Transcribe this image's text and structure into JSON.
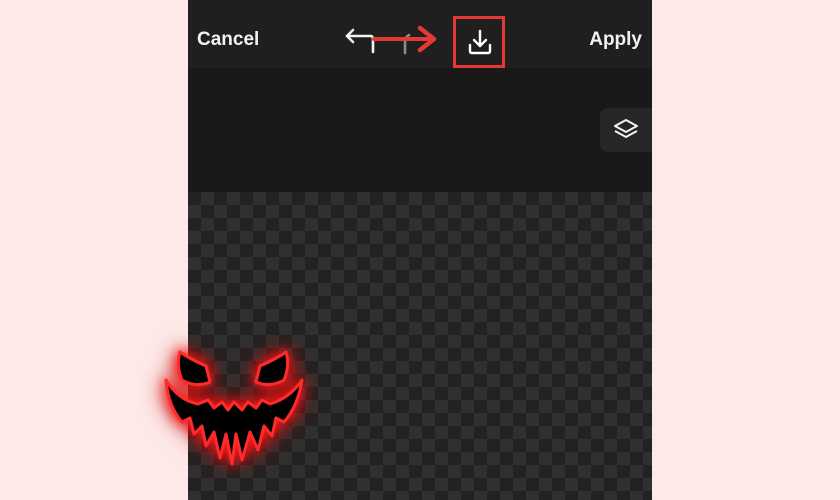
{
  "topbar": {
    "cancel_label": "Cancel",
    "apply_label": "Apply"
  },
  "icons": {
    "undo": "undo-icon",
    "redo": "redo-icon",
    "download": "download-icon",
    "layers": "layers-icon"
  },
  "annotation": {
    "color": "#e53935"
  },
  "canvas": {
    "sticker": "glowing-red-evil-grin"
  }
}
